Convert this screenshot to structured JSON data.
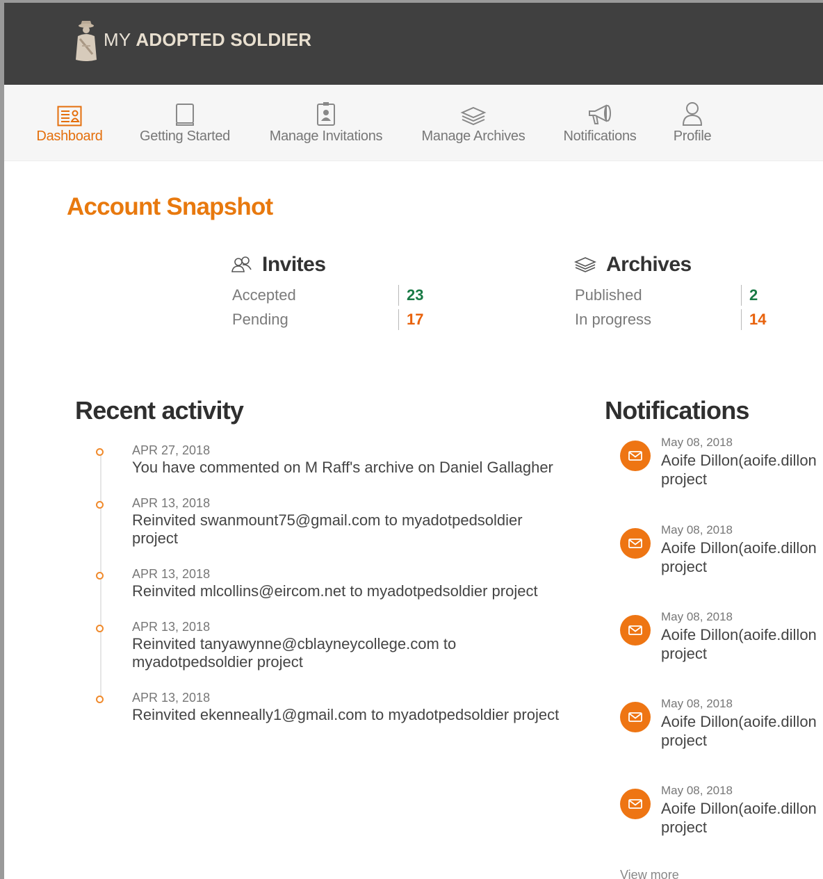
{
  "brand": {
    "prefix": "MY",
    "name": "ADOPTED SOLDIER"
  },
  "nav": {
    "items": [
      {
        "label": "Dashboard",
        "icon": "dashboard-icon",
        "active": true
      },
      {
        "label": "Getting Started",
        "icon": "book-icon"
      },
      {
        "label": "Manage Invitations",
        "icon": "id-badge-icon"
      },
      {
        "label": "Manage Archives",
        "icon": "layers-icon"
      },
      {
        "label": "Notifications",
        "icon": "megaphone-icon"
      },
      {
        "label": "Profile",
        "icon": "user-icon"
      }
    ]
  },
  "snapshot": {
    "title": "Account Snapshot",
    "invites": {
      "heading": "Invites",
      "accepted_label": "Accepted",
      "accepted": "23",
      "pending_label": "Pending",
      "pending": "17"
    },
    "archives": {
      "heading": "Archives",
      "published_label": "Published",
      "published": "2",
      "in_progress_label": "In progress",
      "in_progress": "14"
    }
  },
  "activity": {
    "title": "Recent activity",
    "items": [
      {
        "date": "APR 27, 2018",
        "text": "You have commented on M Raff's archive on Daniel Gallagher"
      },
      {
        "date": "APR 13, 2018",
        "text": "Reinvited swanmount75@gmail.com to myadotpedsoldier project"
      },
      {
        "date": "APR 13, 2018",
        "text": "Reinvited mlcollins@eircom.net to myadotpedsoldier project"
      },
      {
        "date": "APR 13, 2018",
        "text": "Reinvited tanyawynne@cblayneycollege.com to myadotpedsoldier project"
      },
      {
        "date": "APR 13, 2018",
        "text": "Reinvited ekenneally1@gmail.com to myadotpedsoldier project"
      }
    ]
  },
  "notifications": {
    "title": "Notifications",
    "items": [
      {
        "date": "May 08, 2018",
        "line1": "Aoife Dillon(aoife.dillon",
        "line2": "project"
      },
      {
        "date": "May 08, 2018",
        "line1": "Aoife Dillon(aoife.dillon",
        "line2": "project"
      },
      {
        "date": "May 08, 2018",
        "line1": "Aoife Dillon(aoife.dillon",
        "line2": "project"
      },
      {
        "date": "May 08, 2018",
        "line1": "Aoife Dillon(aoife.dillon",
        "line2": "project"
      },
      {
        "date": "May 08, 2018",
        "line1": "Aoife Dillon(aoife.dillon",
        "line2": "project"
      }
    ],
    "view_more": "View more"
  },
  "colors": {
    "accent": "#e8790e",
    "header_bg": "#404040",
    "green": "#1a7a46",
    "orange": "#e8620c"
  }
}
